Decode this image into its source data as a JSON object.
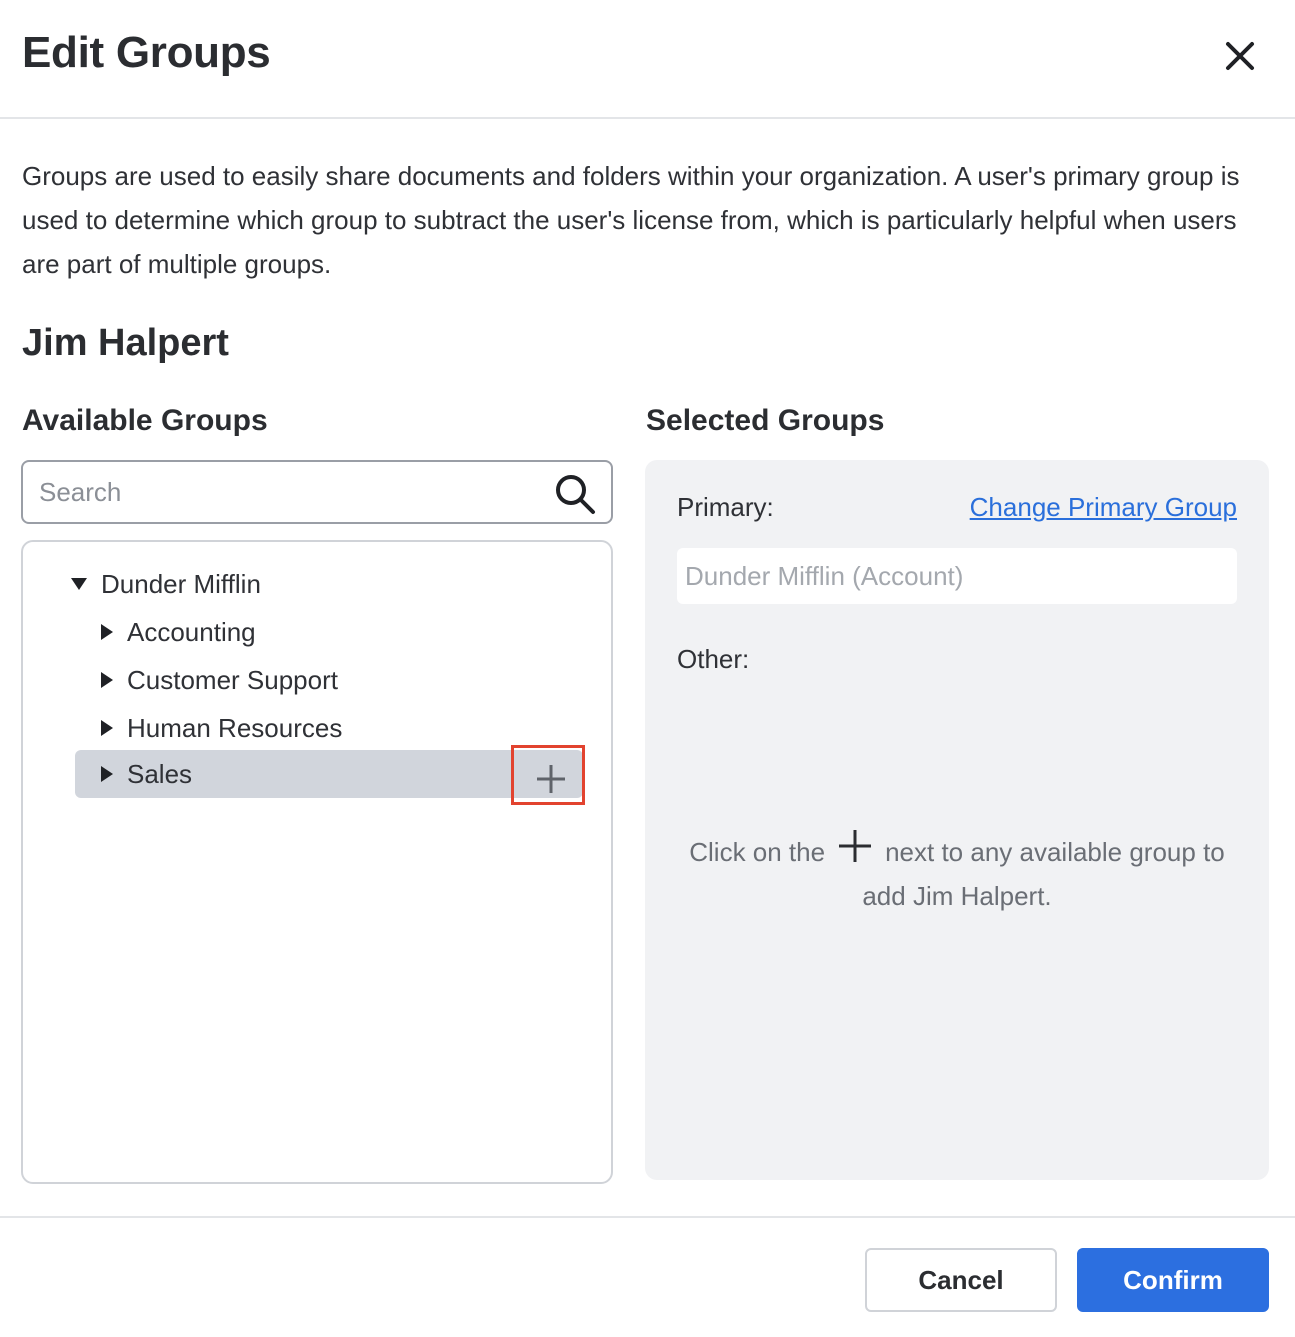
{
  "dialog": {
    "title": "Edit Groups",
    "close_icon": "close-icon",
    "description": "Groups are used to easily share documents and folders within your organization. A user's primary group is used to determine which group to subtract the user's license from, which is particularly helpful when users are part of multiple groups.",
    "user_name": "Jim Halpert"
  },
  "available": {
    "title": "Available Groups",
    "search_placeholder": "Search",
    "search_icon": "search-icon",
    "tree": {
      "root": "Dunder Mifflin",
      "children": [
        "Accounting",
        "Customer Support",
        "Human Resources",
        "Sales"
      ],
      "selected": "Sales",
      "add_icon": "plus-icon"
    }
  },
  "selected": {
    "title": "Selected Groups",
    "primary_label": "Primary:",
    "change_link": "Change Primary Group",
    "primary_value": "Dunder Mifflin (Account)",
    "other_label": "Other:",
    "hint_before": "Click on the",
    "hint_after": "next to any available group to",
    "hint_line2": "add Jim Halpert."
  },
  "footer": {
    "cancel_label": "Cancel",
    "confirm_label": "Confirm"
  },
  "colors": {
    "accent": "#2c6fe0",
    "link": "#2a6fdb",
    "highlight_border": "#e2432f",
    "selected_row": "#d1d5dc",
    "panel_bg": "#f1f2f4"
  }
}
